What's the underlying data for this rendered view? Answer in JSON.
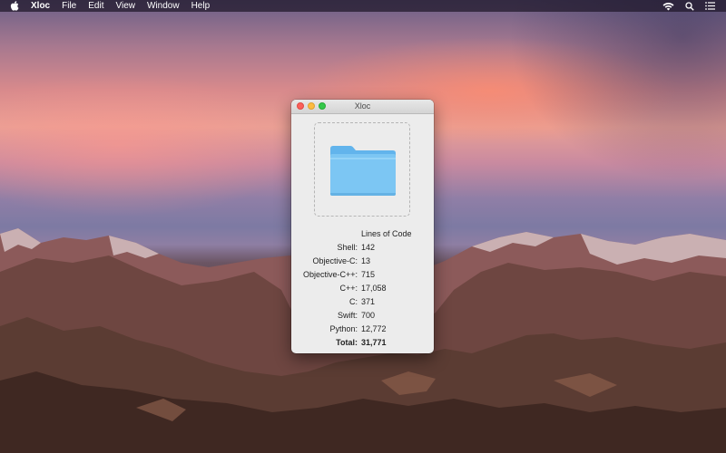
{
  "menubar": {
    "app_name": "Xloc",
    "items": [
      "File",
      "Edit",
      "View",
      "Window",
      "Help"
    ]
  },
  "window": {
    "title": "Xloc",
    "column_header": "Lines of Code",
    "rows": [
      {
        "language": "Shell:",
        "count": "142"
      },
      {
        "language": "Objective-C:",
        "count": "13"
      },
      {
        "language": "Objective-C++:",
        "count": "715"
      },
      {
        "language": "C++:",
        "count": "17,058"
      },
      {
        "language": "C:",
        "count": "371"
      },
      {
        "language": "Swift:",
        "count": "700"
      },
      {
        "language": "Python:",
        "count": "12,772"
      }
    ],
    "total": {
      "language": "Total:",
      "count": "31,771"
    }
  },
  "icons": {
    "apple": "apple-logo-icon",
    "wifi": "wifi-icon",
    "search": "spotlight-search-icon",
    "list": "notification-center-icon",
    "folder": "folder-icon"
  },
  "colors": {
    "close": "#fc605b",
    "minimize": "#fdbc40",
    "zoom": "#34c84a",
    "folder": "#7cc6f3"
  }
}
